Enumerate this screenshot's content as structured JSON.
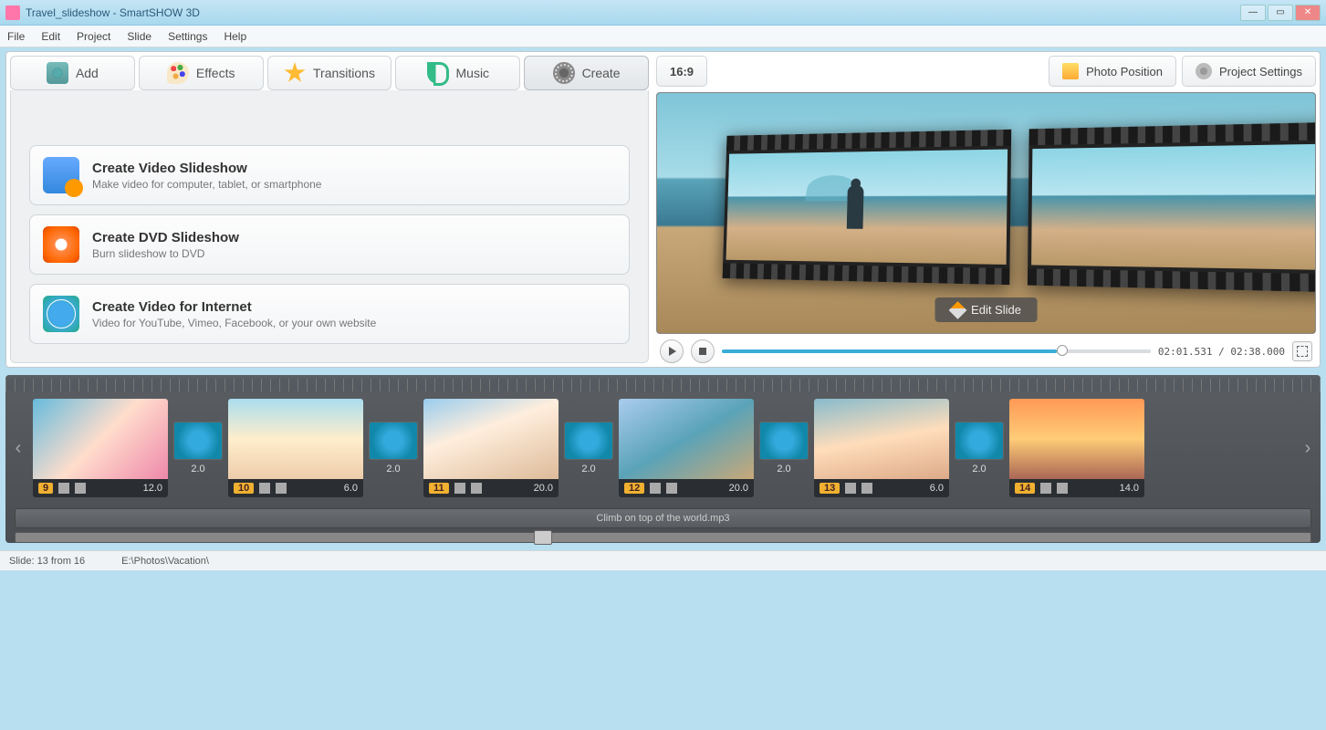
{
  "window": {
    "title": "Travel_slideshow - SmartSHOW 3D"
  },
  "menu": {
    "file": "File",
    "edit": "Edit",
    "project": "Project",
    "slide": "Slide",
    "settings": "Settings",
    "help": "Help"
  },
  "tabs": {
    "add": "Add",
    "effects": "Effects",
    "transitions": "Transitions",
    "music": "Music",
    "create": "Create"
  },
  "create_options": {
    "video": {
      "title": "Create Video Slideshow",
      "desc": "Make video for computer, tablet, or smartphone"
    },
    "dvd": {
      "title": "Create DVD Slideshow",
      "desc": "Burn slideshow to DVD"
    },
    "internet": {
      "title": "Create Video for Internet",
      "desc": "Video for YouTube, Vimeo, Facebook, or your own website"
    }
  },
  "preview": {
    "aspect": "16:9",
    "photo_position": "Photo Position",
    "project_settings": "Project Settings",
    "edit_slide": "Edit Slide",
    "time": "02:01.531 / 02:38.000"
  },
  "timeline": {
    "slides": [
      {
        "num": "9",
        "dur": "12.0",
        "trans": "2.0"
      },
      {
        "num": "10",
        "dur": "6.0",
        "trans": "2.0"
      },
      {
        "num": "11",
        "dur": "20.0",
        "trans": "2.0"
      },
      {
        "num": "12",
        "dur": "20.0",
        "trans": "2.0"
      },
      {
        "num": "13",
        "dur": "6.0",
        "trans": "2.0"
      },
      {
        "num": "14",
        "dur": "14.0",
        "trans": "2.0"
      }
    ],
    "audio": "Climb on top of the world.mp3"
  },
  "status": {
    "slide": "Slide: 13 from 16",
    "path": "E:\\Photos\\Vacation\\"
  }
}
